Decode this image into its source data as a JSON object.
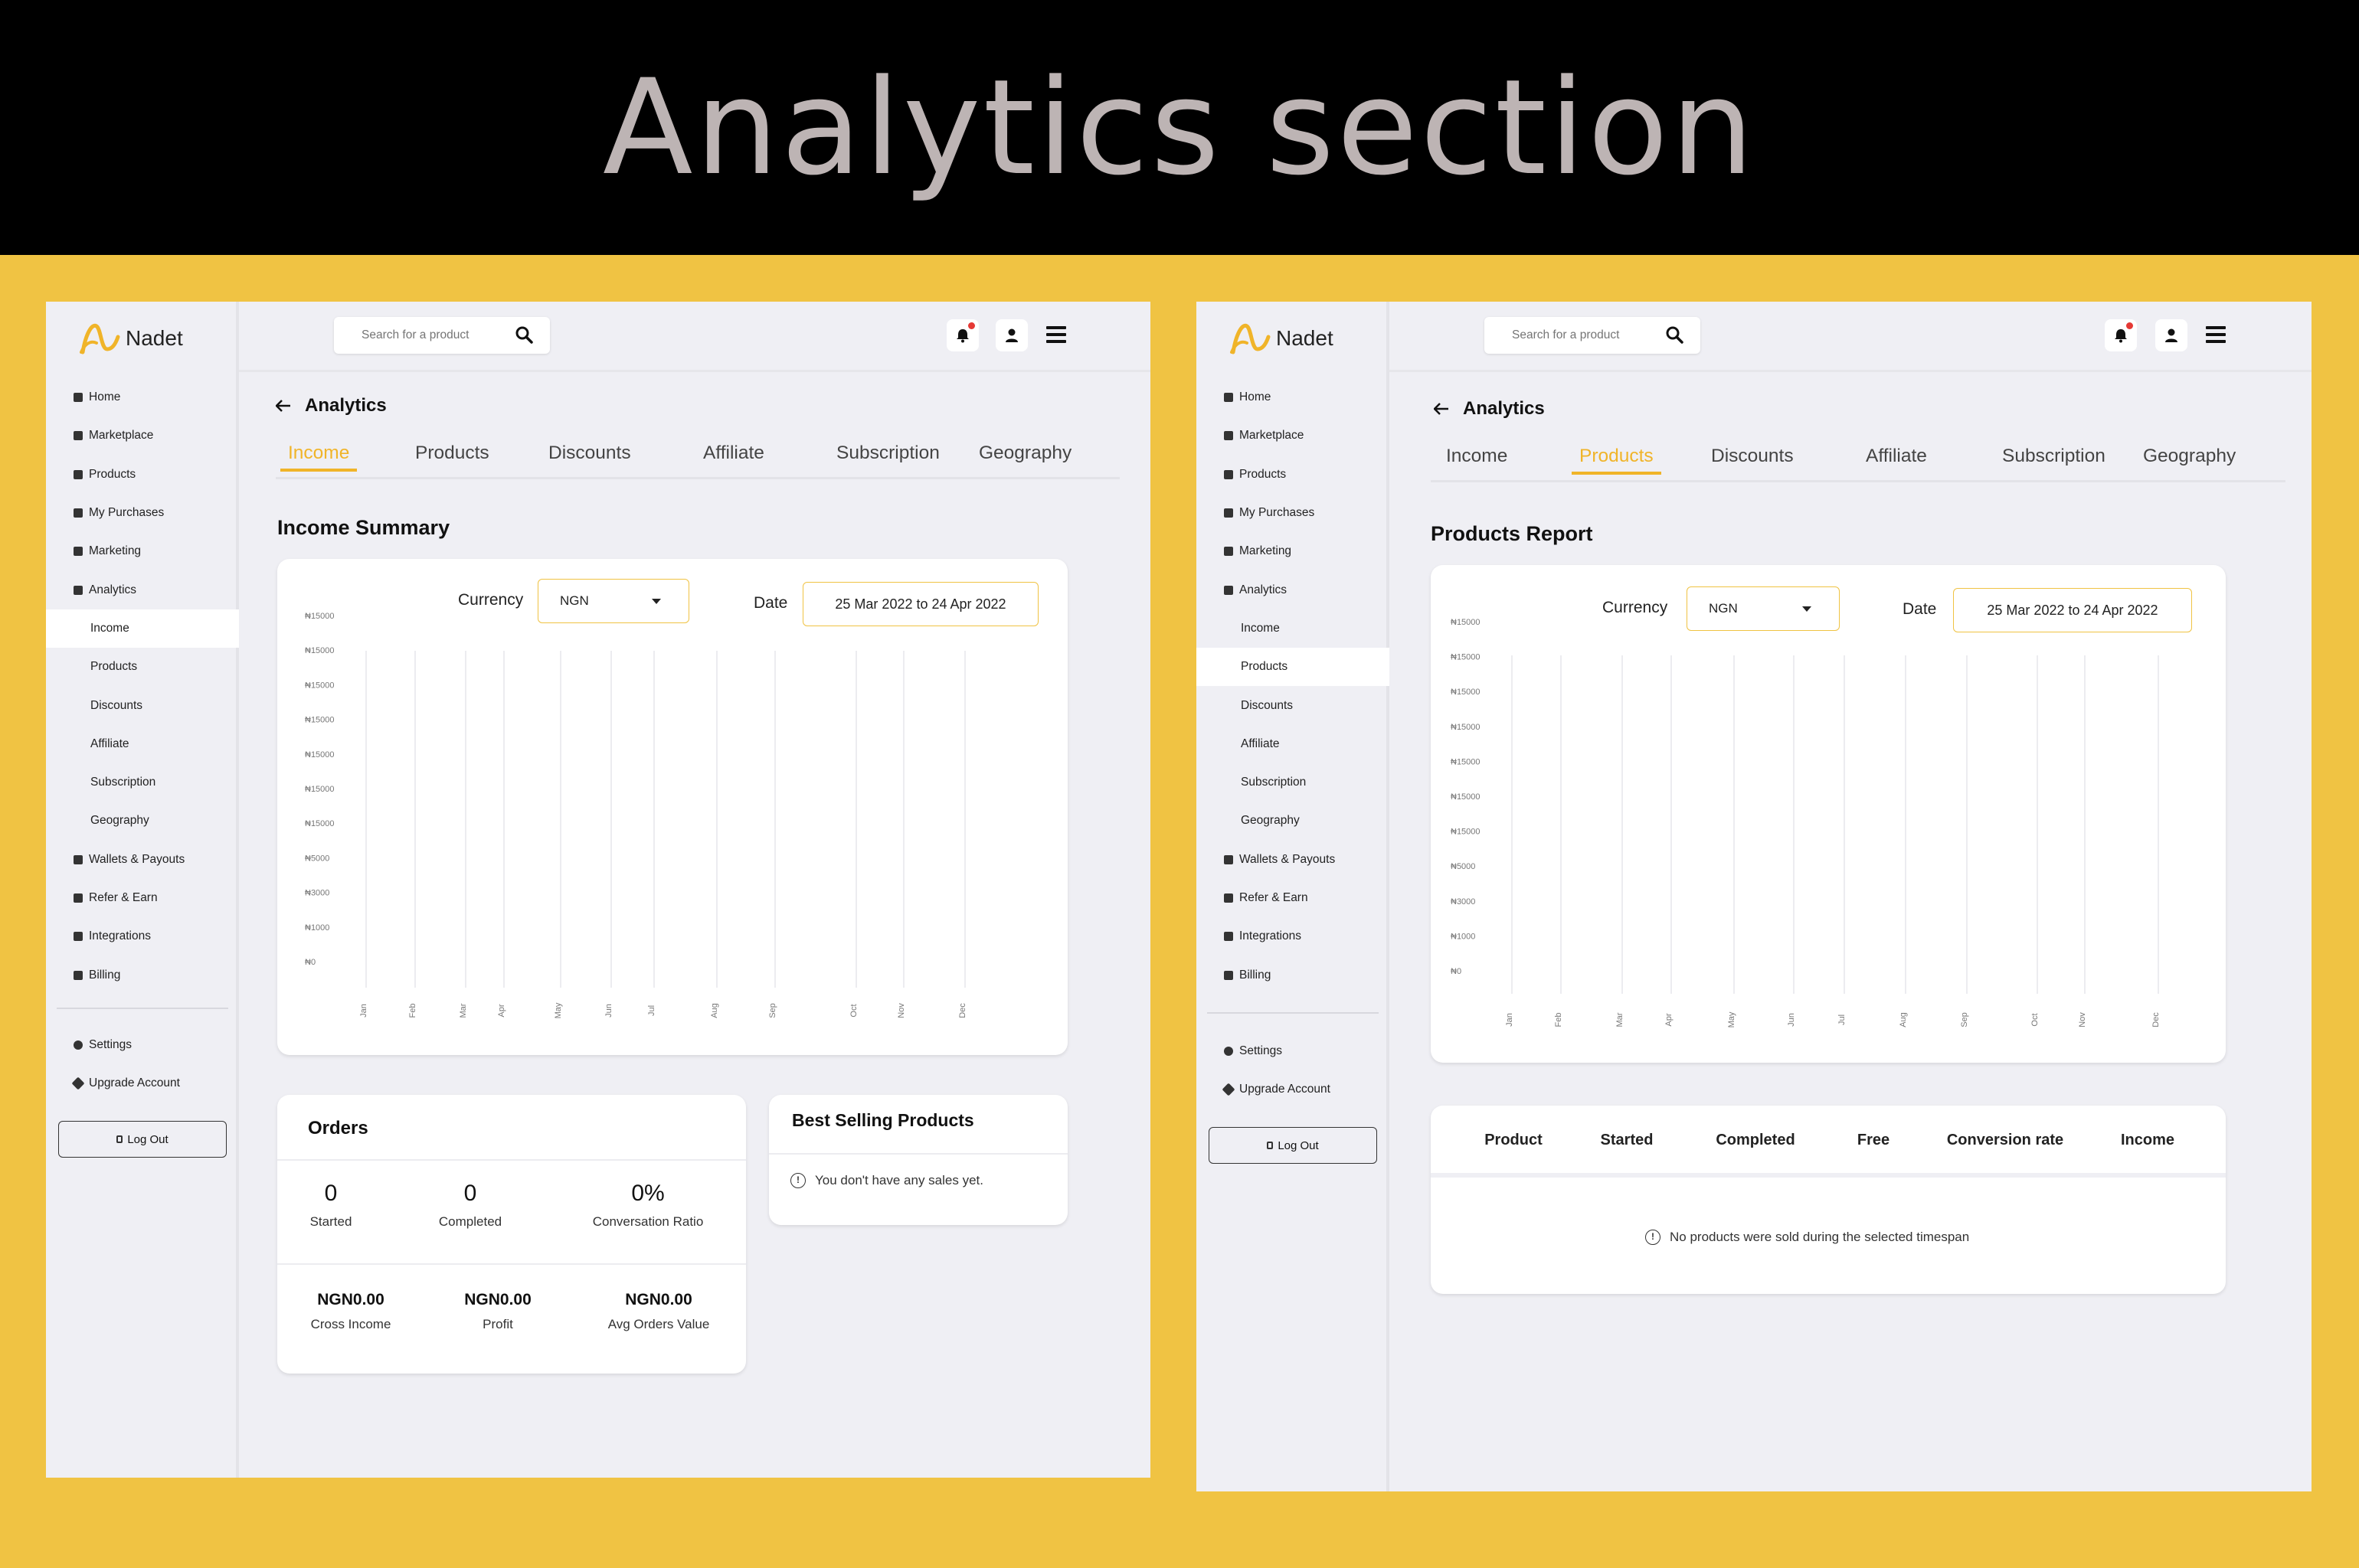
{
  "banner": {
    "title": "Analytics section"
  },
  "app": {
    "brand": "Nadet",
    "search_placeholder": "Search for a product",
    "nav": [
      {
        "label": "Home",
        "icon": "home-icon"
      },
      {
        "label": "Marketplace",
        "icon": "store-icon"
      },
      {
        "label": "Products",
        "icon": "box-icon"
      },
      {
        "label": "My Purchases",
        "icon": "purchases-icon"
      },
      {
        "label": "Marketing",
        "icon": "tag-icon"
      },
      {
        "label": "Analytics",
        "icon": "bar-chart-icon"
      }
    ],
    "analytics_sub": [
      "Income",
      "Products",
      "Discounts",
      "Affiliate",
      "Subscription",
      "Geography"
    ],
    "nav_bottom": [
      {
        "label": "Wallets & Payouts",
        "icon": "wallet-icon"
      },
      {
        "label": "Refer & Earn",
        "icon": "users-icon"
      },
      {
        "label": "Integrations",
        "icon": "puzzle-icon"
      },
      {
        "label": "Billing",
        "icon": "billing-icon"
      }
    ],
    "settings": "Settings",
    "upgrade": "Upgrade Account",
    "logout": "Log Out",
    "page_title": "Analytics",
    "tabs": [
      "Income",
      "Products",
      "Discounts",
      "Affiliate",
      "Subscription",
      "Geography"
    ],
    "currency_label": "Currency",
    "currency_value": "NGN",
    "date_label": "Date",
    "date_value": "25 Mar 2022 to 24 Apr 2022",
    "accent": "#f0b429"
  },
  "left": {
    "active_tab": "Income",
    "section_title": "Income Summary",
    "orders": {
      "title": "Orders",
      "stats": [
        {
          "value": "0",
          "label": "Started"
        },
        {
          "value": "0",
          "label": "Completed"
        },
        {
          "value": "0%",
          "label": "Conversation Ratio"
        }
      ],
      "money": [
        {
          "value": "NGN0.00",
          "label": "Cross Income"
        },
        {
          "value": "NGN0.00",
          "label": "Profit"
        },
        {
          "value": "NGN0.00",
          "label": "Avg Orders Value"
        }
      ]
    },
    "best_selling": {
      "title": "Best Selling Products",
      "empty": "You don't have any sales yet."
    }
  },
  "right": {
    "active_tab": "Products",
    "section_title": "Products Report",
    "table": {
      "columns": [
        "Product",
        "Started",
        "Completed",
        "Free",
        "Conversion rate",
        "Income"
      ],
      "empty": "No products were sold during the selected timespan"
    }
  },
  "chart_data": [
    {
      "type": "line",
      "title": "",
      "xlabel": "",
      "ylabel": "",
      "categories": [
        "Jan",
        "Feb",
        "Mar",
        "Apr",
        "May",
        "Jun",
        "Jul",
        "Aug",
        "Sep",
        "Oct",
        "Nov",
        "Dec"
      ],
      "y_tick_labels": [
        "₦15000",
        "₦15000",
        "₦15000",
        "₦15000",
        "₦15000",
        "₦15000",
        "₦15000",
        "₦5000",
        "₦3000",
        "₦1000",
        "₦0"
      ],
      "series": [],
      "grid": "vertical"
    },
    {
      "type": "line",
      "title": "",
      "xlabel": "",
      "ylabel": "",
      "categories": [
        "Jan",
        "Feb",
        "Mar",
        "Apr",
        "May",
        "Jun",
        "Jul",
        "Aug",
        "Sep",
        "Oct",
        "Nov",
        "Dec"
      ],
      "y_tick_labels": [
        "₦15000",
        "₦15000",
        "₦15000",
        "₦15000",
        "₦15000",
        "₦15000",
        "₦15000",
        "₦5000",
        "₦3000",
        "₦1000",
        "₦0"
      ],
      "series": [],
      "grid": "vertical"
    }
  ]
}
